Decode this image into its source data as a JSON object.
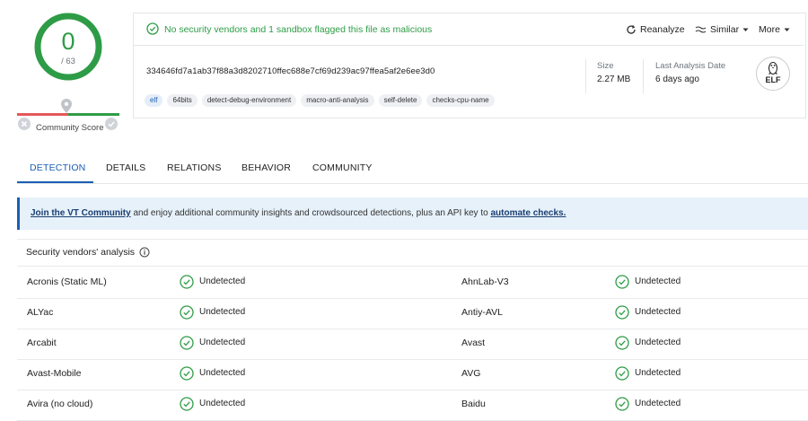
{
  "score": {
    "detections": "0",
    "total": "/ 63",
    "community_label": "Community Score"
  },
  "banner": {
    "message": "No security vendors and 1 sandbox flagged this file as malicious"
  },
  "actions": {
    "reanalyze": "Reanalyze",
    "similar": "Similar",
    "more": "More"
  },
  "file": {
    "hash": "334646fd7a1ab37f88a3d8202710ffec688e7cf69d239ac97ffea5af2e6ee3d0",
    "tags": [
      "elf",
      "64bits",
      "detect-debug-environment",
      "macro-anti-analysis",
      "self-delete",
      "checks-cpu-name"
    ],
    "size_label": "Size",
    "size_value": "2.27 MB",
    "last_analysis_label": "Last Analysis Date",
    "last_analysis_value": "6 days ago",
    "type_label": "ELF"
  },
  "tabs": [
    "DETECTION",
    "DETAILS",
    "RELATIONS",
    "BEHAVIOR",
    "COMMUNITY"
  ],
  "community_banner": {
    "link": "Join the VT Community",
    "text": " and enjoy additional community insights and crowdsourced detections, plus an API key to ",
    "link2": "automate checks."
  },
  "vendors_title": "Security vendors' analysis",
  "vendors": [
    {
      "left": "Acronis (Static ML)",
      "left_result": "Undetected",
      "right": "AhnLab-V3",
      "right_result": "Undetected"
    },
    {
      "left": "ALYac",
      "left_result": "Undetected",
      "right": "Antiy-AVL",
      "right_result": "Undetected"
    },
    {
      "left": "Arcabit",
      "left_result": "Undetected",
      "right": "Avast",
      "right_result": "Undetected"
    },
    {
      "left": "Avast-Mobile",
      "left_result": "Undetected",
      "right": "AVG",
      "right_result": "Undetected"
    },
    {
      "left": "Avira (no cloud)",
      "left_result": "Undetected",
      "right": "Baidu",
      "right_result": "Undetected"
    }
  ],
  "colors": {
    "green": "#2e9c46",
    "blue": "#1a5fb4",
    "red": "#e45858"
  }
}
